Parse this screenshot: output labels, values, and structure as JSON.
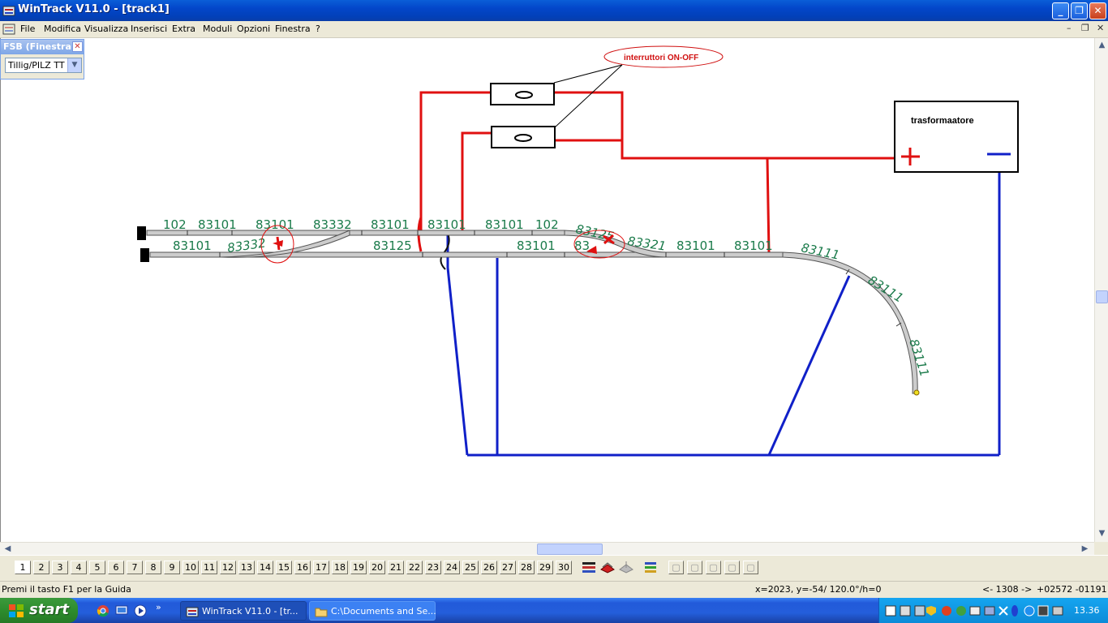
{
  "window": {
    "title": "WinTrack  V11.0 - [track1]",
    "buttons": {
      "minimize": "_",
      "maximize": "❐",
      "close": "✕"
    }
  },
  "menu": {
    "items": [
      "File",
      "Modifica",
      "Visualizza",
      "Inserisci",
      "Extra",
      "Moduli",
      "Opzioni",
      "Finestra",
      "?"
    ],
    "mdi_buttons": [
      "–",
      "❐",
      "✕"
    ]
  },
  "toolbox": {
    "title": "FSB (Finestra...",
    "select_value": "Tillig/PILZ  TT I"
  },
  "drawing": {
    "callout_label": "interruttori ON-OFF",
    "transformer_label": "trasformaatore",
    "plus_symbol": "+",
    "track_labels_top": [
      "102",
      "83101",
      "83101",
      "83332",
      "83101",
      "83101",
      "83101",
      "102",
      "83125"
    ],
    "track_labels_bottom": [
      "83101",
      "83332",
      "83125",
      "83101",
      "83",
      "83321",
      "83101",
      "83101"
    ],
    "curve_labels": [
      "83111",
      "83111",
      "83111"
    ],
    "colors": {
      "wire_positive": "#e01010",
      "wire_negative": "#1020c8",
      "track_fill": "#cccccc",
      "label_color": "#1a7a4a"
    }
  },
  "page_toolbar": {
    "pages": [
      "1",
      "2",
      "3",
      "4",
      "5",
      "6",
      "7",
      "8",
      "9",
      "10",
      "11",
      "12",
      "13",
      "14",
      "15",
      "16",
      "17",
      "18",
      "19",
      "20",
      "21",
      "22",
      "23",
      "24",
      "25",
      "26",
      "27",
      "28",
      "29",
      "30"
    ],
    "active_page": "1",
    "icons": [
      "layers-icon",
      "layer-red-icon",
      "layer-gray-icon",
      "layer-stack-icon",
      "view-1-icon",
      "view-2-icon",
      "view-3-icon",
      "view-4-icon",
      "view-5-icon"
    ]
  },
  "status": {
    "help_text": "Premi il tasto F1 per la Guida",
    "coords": "x=2023, y=-54/ 120.0°/h=0",
    "length": "<- 1308 ->",
    "offset": "+02572  -01191"
  },
  "taskbar": {
    "start_label": "start",
    "tasks": [
      "WinTrack  V11.0 - [tr...",
      "C:\\Documents and Se..."
    ],
    "clock": "13.36"
  }
}
